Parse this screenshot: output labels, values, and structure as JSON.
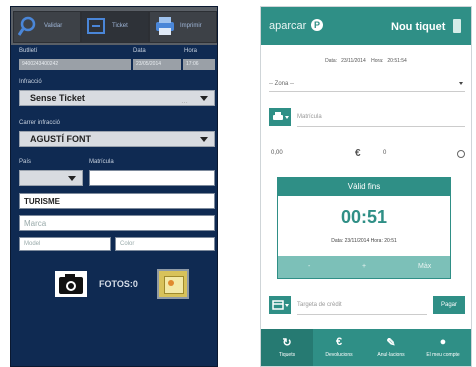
{
  "left_app": {
    "toolbar": {
      "validate_label": "Validar",
      "ticket_label": "Ticket",
      "print_label": "Imprimir"
    },
    "fields": {
      "butlleti_label": "Butlletí",
      "butlleti_value": "9400243400242",
      "data_label": "Data",
      "data_value": "23/05/2014",
      "hora_label": "Hora",
      "hora_value": "17:06",
      "infraccio_label": "Infracció",
      "infraccio_value": "Sense Ticket",
      "carrer_label": "Carrer infracció",
      "carrer_value": "AGUSTÍ FONT",
      "pais_label": "País",
      "matricula_label": "Matrícula",
      "tipus_value": "TURISME",
      "marca_placeholder": "Marca",
      "model_placeholder": "Model",
      "color_placeholder": "Color"
    },
    "fotos_label": "FOTOS:0"
  },
  "right_app": {
    "logo_text": "aparcar",
    "header_title": "Nou tiquet",
    "date_label": "Data:",
    "date_value": "23/11/2014",
    "hour_label": "Hora:",
    "hour_value": "20:51:54",
    "zona_placeholder": "-- Zona --",
    "matricula_placeholder": "Matrícula",
    "amount_value": "0,00",
    "currency_symbol": "€",
    "minutes_value": "0",
    "valid_title": "Vàlid fins",
    "valid_time": "00:51",
    "valid_date_label": "Data:",
    "valid_date_value": "23/11/2014",
    "valid_hour_label": "Hora:",
    "valid_hour_value": "20:51",
    "valid_bar": {
      "minus": "-",
      "plus": "+",
      "max": "Màx"
    },
    "card_placeholder": "Targeta de crèdit",
    "pay_label": "Pagar",
    "nav": [
      {
        "icon": "ticket-icon",
        "glyph": "↻",
        "label": "Tiquets"
      },
      {
        "icon": "euro-icon",
        "glyph": "€",
        "label": "Devolucions"
      },
      {
        "icon": "eraser-icon",
        "glyph": "✎",
        "label": "Anul·lacions"
      },
      {
        "icon": "user-icon",
        "glyph": "●",
        "label": "El meu compte"
      }
    ]
  },
  "colors": {
    "left_bg": "#0f2a52",
    "right_accent": "#2f8f86"
  }
}
